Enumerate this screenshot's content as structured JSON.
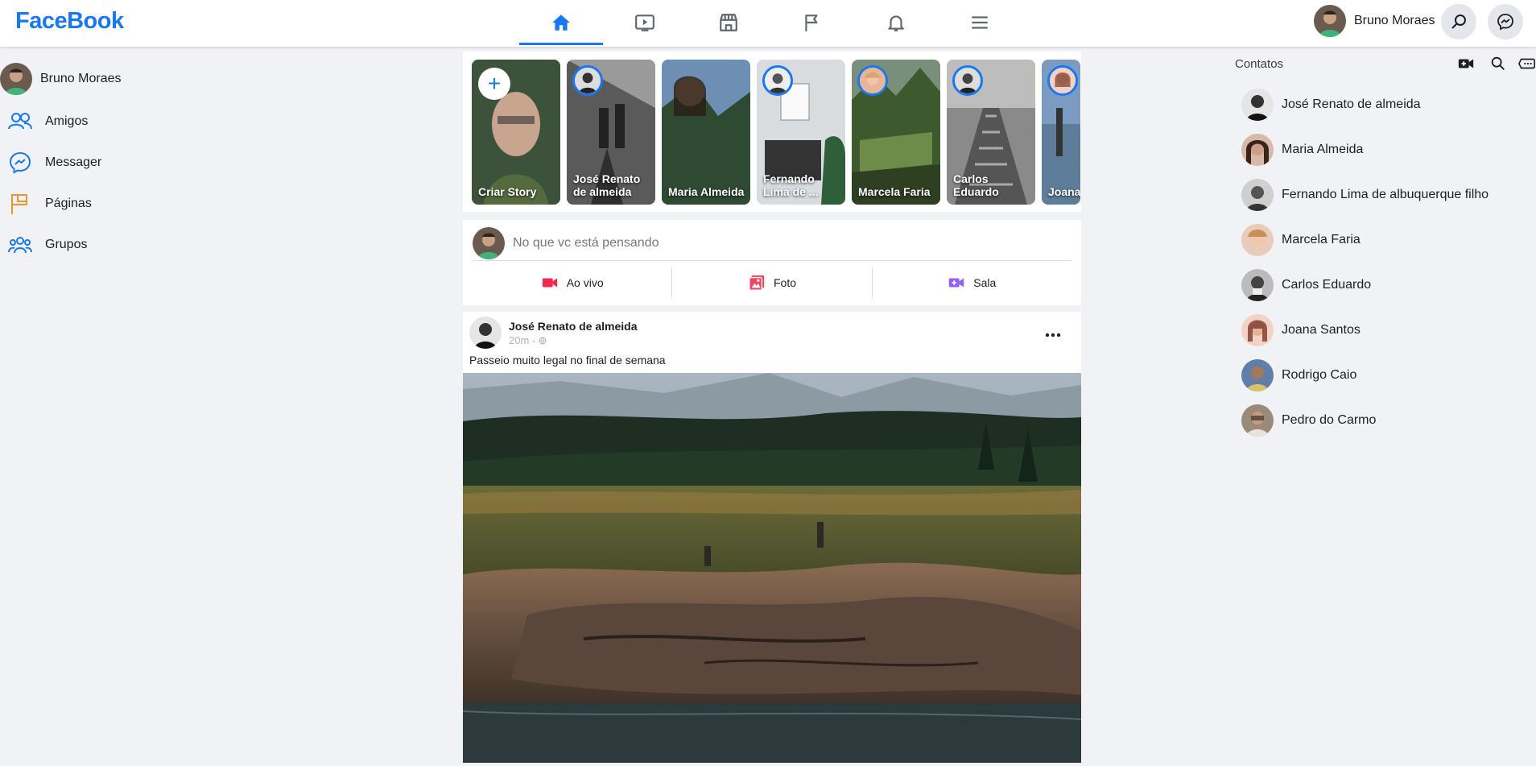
{
  "header": {
    "logo": "FaceBook",
    "user_name": "Bruno Moraes",
    "tabs": [
      "home-icon",
      "watch-icon",
      "marketplace-icon",
      "pages-icon",
      "notifications-icon",
      "menu-icon"
    ]
  },
  "sidebar": {
    "user": "Bruno Moraes",
    "items": [
      {
        "label": "Amigos",
        "icon": "friends-icon"
      },
      {
        "label": "Messager",
        "icon": "messenger-icon"
      },
      {
        "label": "Páginas",
        "icon": "pages-icon"
      },
      {
        "label": "Grupos",
        "icon": "groups-icon"
      }
    ]
  },
  "stories": [
    {
      "name": "Criar Story"
    },
    {
      "name": "José Renato de almeida"
    },
    {
      "name": "Maria Almeida"
    },
    {
      "name": "Fernando Lima de ..."
    },
    {
      "name": "Marcela Faria"
    },
    {
      "name": "Carlos Eduardo"
    },
    {
      "name": "Joana"
    }
  ],
  "composer": {
    "placeholder": "No que vc está pensando",
    "actions": [
      "Ao vivo",
      "Foto",
      "Sala"
    ]
  },
  "post": {
    "author": "José Renato de almeida",
    "time": "20m - ",
    "text": "Passeio muito legal no final de semana"
  },
  "contacts": {
    "title": "Contatos",
    "items": [
      "José Renato de almeida",
      "Maria Almeida",
      "Fernando Lima de albuquerque filho",
      "Marcela Faria",
      "Carlos Eduardo",
      "Joana Santos",
      "Rodrigo Caio",
      "Pedro do Carmo"
    ]
  },
  "colors": {
    "brand": "#1877f2",
    "background": "#f0f2f5",
    "live": "#f02849",
    "photo": "#f3425f",
    "room": "#9360f7"
  }
}
